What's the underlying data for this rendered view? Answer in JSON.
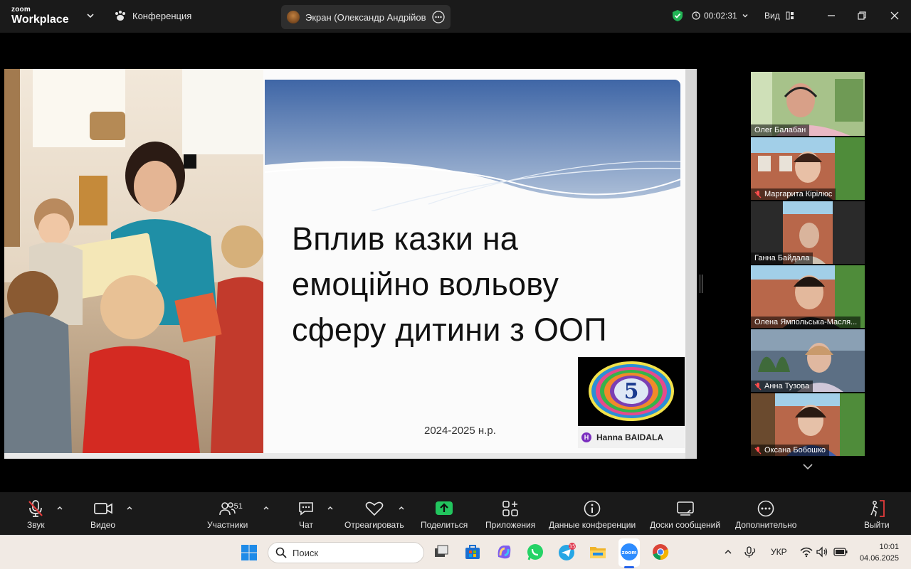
{
  "app": {
    "logo_top": "zoom",
    "logo_bottom": "Workplace"
  },
  "topbar": {
    "conference_label": "Конференция",
    "share_label": "Экран (Олександр Андрійович Г",
    "timer": "00:02:31",
    "view_label": "Вид",
    "accent_green": "#22b455"
  },
  "slide": {
    "title_lines": [
      "Вплив казки на",
      "емоційно вольову",
      "сферу дитини з ООП"
    ],
    "year": "2024-2025 н.р.",
    "logo_digit": "5",
    "author_initial": "H",
    "author": "Hanna BAIDALA"
  },
  "participants": [
    {
      "name": "Олег Балабан",
      "muted": false,
      "active": true
    },
    {
      "name": "Маргарита Кірілюс",
      "muted": true,
      "active": false
    },
    {
      "name": "Ганна Байдала",
      "muted": false,
      "active": false
    },
    {
      "name": "Олена Ямпольська-Масля...",
      "muted": false,
      "active": false
    },
    {
      "name": "Анна Тузова",
      "muted": true,
      "active": false
    },
    {
      "name": "Оксана Бобошко",
      "muted": true,
      "active": false
    }
  ],
  "toolbar": {
    "audio": "Звук",
    "video": "Видео",
    "participants": "Участники",
    "participants_count": "51",
    "chat": "Чат",
    "react": "Отреагировать",
    "share": "Поделиться",
    "apps": "Приложения",
    "info": "Данные конференции",
    "whiteboards": "Доски сообщений",
    "more": "Дополнительно",
    "leave": "Выйти",
    "share_green": "#22c55e",
    "leave_red": "#e23b3b"
  },
  "taskbar": {
    "search_placeholder": "Поиск",
    "telegram_badge": "35",
    "language": "УКР",
    "time": "10:01",
    "date": "04.06.2025"
  }
}
